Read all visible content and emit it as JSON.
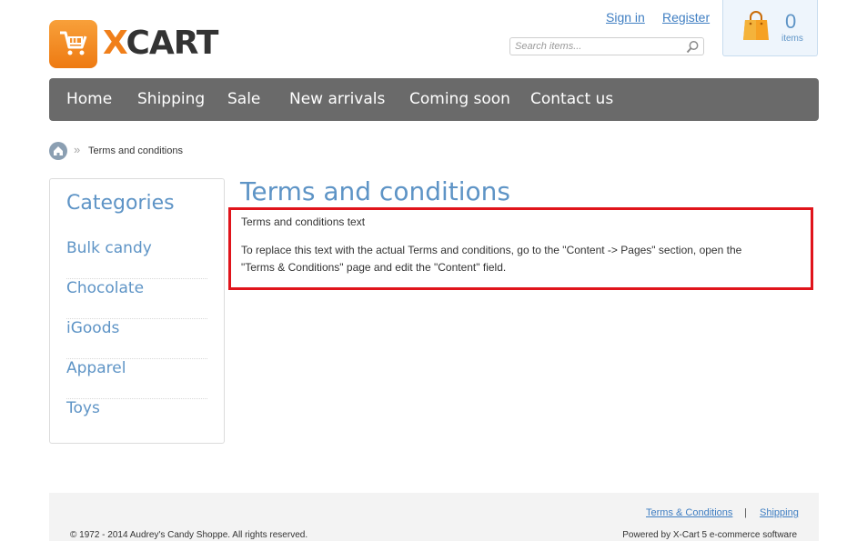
{
  "brand": {
    "logo_text_x": "X",
    "logo_text_cart": "CART",
    "accent": "#f07f1a"
  },
  "header": {
    "sign_in": "Sign in",
    "register": "Register",
    "search_placeholder": "Search items...",
    "cart_count": "0",
    "cart_label": "items"
  },
  "nav": {
    "items": [
      "Home",
      "Shipping",
      "Sale",
      "New arrivals",
      "Coming soon",
      "Contact us"
    ]
  },
  "breadcrumb": {
    "separator": "»",
    "current": "Terms and conditions"
  },
  "sidebar": {
    "title": "Categories",
    "items": [
      "Bulk candy",
      "Chocolate",
      "iGoods",
      "Apparel",
      "Toys"
    ]
  },
  "main": {
    "title": "Terms and conditions",
    "text_line1": "Terms and conditions text",
    "text_line2": "To replace this text with the actual Terms and conditions, go to the \"Content -> Pages\" section, open the",
    "text_line3": "\"Terms & Conditions\" page and edit the \"Content\" field."
  },
  "footer": {
    "link_terms": "Terms & Conditions",
    "separator": "|",
    "link_shipping": "Shipping",
    "copyright": "© 1972 - 2014 Audrey's Candy Shoppe. All rights reserved.",
    "powered": "Powered by X-Cart 5 e-commerce software"
  },
  "colors": {
    "link": "#3f7ec2",
    "heading": "#5e94c6",
    "nav_bg": "#6a6a6a",
    "highlight_border": "#e0141b"
  }
}
